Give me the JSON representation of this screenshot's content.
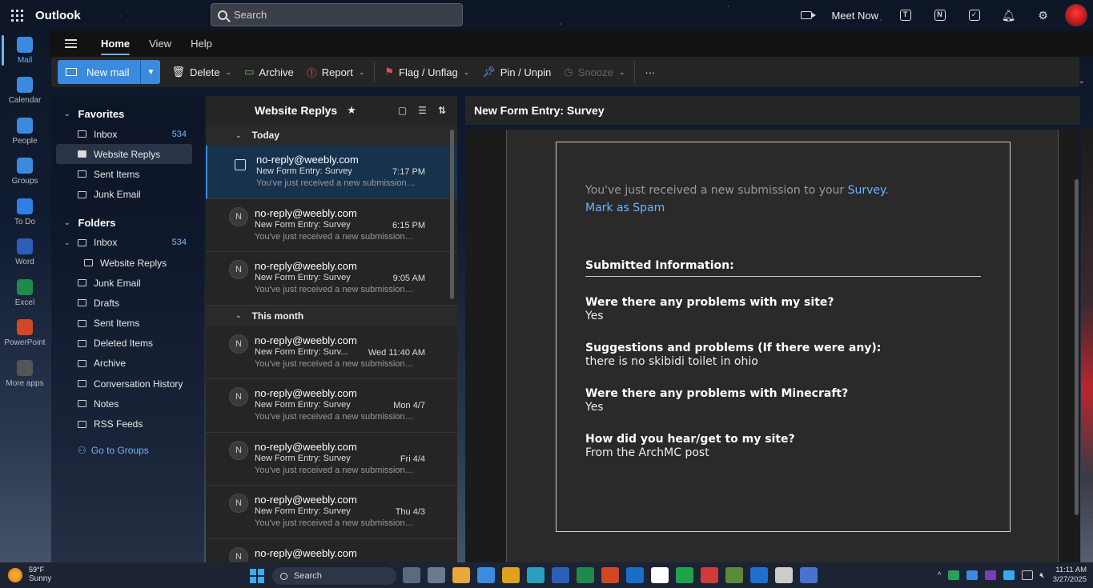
{
  "app": {
    "name": "Outlook",
    "search_placeholder": "Search",
    "meet_now": "Meet Now"
  },
  "rail": [
    {
      "label": "Mail",
      "icon": "mail-icon",
      "color": "#3a8ae0"
    },
    {
      "label": "Calendar",
      "icon": "calendar-icon",
      "color": "#3a8ae0"
    },
    {
      "label": "People",
      "icon": "people-icon",
      "color": "#3a8ae0"
    },
    {
      "label": "Groups",
      "icon": "groups-icon",
      "color": "#3a8ae0"
    },
    {
      "label": "To Do",
      "icon": "todo-icon",
      "color": "#2f7fe6"
    },
    {
      "label": "Word",
      "icon": "word-icon",
      "color": "#2b5fb8"
    },
    {
      "label": "Excel",
      "icon": "excel-icon",
      "color": "#1f8a4c"
    },
    {
      "label": "PowerPoint",
      "icon": "powerpoint-icon",
      "color": "#d24726"
    },
    {
      "label": "More apps",
      "icon": "more-apps-icon",
      "color": "#555555"
    }
  ],
  "menu": {
    "tabs": [
      "Home",
      "View",
      "Help"
    ]
  },
  "ribbon": {
    "new_mail": "New mail",
    "delete": "Delete",
    "archive": "Archive",
    "report": "Report",
    "flag": "Flag / Unflag",
    "pin": "Pin / Unpin",
    "snooze": "Snooze",
    "more": "···"
  },
  "folders": {
    "favorites_title": "Favorites",
    "favorites": [
      {
        "label": "Inbox",
        "count": "534"
      },
      {
        "label": "Website Replys",
        "count": ""
      },
      {
        "label": "Sent Items",
        "count": ""
      },
      {
        "label": "Junk Email",
        "count": ""
      }
    ],
    "folders_title": "Folders",
    "inbox": {
      "label": "Inbox",
      "count": "534"
    },
    "inbox_sub": "Website Replys",
    "items": [
      "Junk Email",
      "Drafts",
      "Sent Items",
      "Deleted Items",
      "Archive",
      "Conversation History",
      "Notes",
      "RSS Feeds"
    ],
    "groups_link": "Go to Groups"
  },
  "message_list": {
    "title": "Website Replys",
    "sections": [
      "Today",
      "This month"
    ],
    "today": [
      {
        "from": "no-reply@weebly.com",
        "subject": "New Form Entry: Survey",
        "time": "7:17 PM",
        "preview": "You've just received a new submission t..."
      },
      {
        "from": "no-reply@weebly.com",
        "subject": "New Form Entry: Survey",
        "time": "6:15 PM",
        "preview": "You've just received a new submission t..."
      },
      {
        "from": "no-reply@weebly.com",
        "subject": "New Form Entry: Survey",
        "time": "9:05 AM",
        "preview": "You've just received a new submission t..."
      }
    ],
    "month": [
      {
        "from": "no-reply@weebly.com",
        "subject": "New Form Entry: Surv...",
        "time": "Wed 11:40 AM",
        "preview": "You've just received a new submission t..."
      },
      {
        "from": "no-reply@weebly.com",
        "subject": "New Form Entry: Survey",
        "time": "Mon 4/7",
        "preview": "You've just received a new submission t..."
      },
      {
        "from": "no-reply@weebly.com",
        "subject": "New Form Entry: Survey",
        "time": "Fri 4/4",
        "preview": "You've just received a new submission t..."
      },
      {
        "from": "no-reply@weebly.com",
        "subject": "New Form Entry: Survey",
        "time": "Thu 4/3",
        "preview": "You've just received a new submission t..."
      },
      {
        "from": "no-reply@weebly.com",
        "subject": "",
        "time": "",
        "preview": ""
      }
    ],
    "avatar_letter": "N"
  },
  "reading": {
    "title": "New Form Entry: Survey",
    "intro_prefix": "You've just received a new submission to your",
    "intro_link": "Survey",
    "intro_suffix": ".",
    "spam": "Mark as Spam",
    "submitted": "Submitted Information:",
    "qa": [
      {
        "q": "Were there any problems with my site?",
        "a": "Yes"
      },
      {
        "q": "Suggestions and problems (If there were any):",
        "a": "there is no skibidi toilet in ohio"
      },
      {
        "q": "Were there any problems with Minecraft?",
        "a": "Yes"
      },
      {
        "q": "How did you hear/get to my site?",
        "a": "From the ArchMC post"
      }
    ]
  },
  "taskbar": {
    "temp": "59°F",
    "weather": "Sunny",
    "search": "Search",
    "time": "11:11 AM",
    "date": "3/27/2025",
    "apps": [
      "file-explorer-icon",
      "settings-icon",
      "folder-icon",
      "store-icon",
      "chrome-icon",
      "edge-icon",
      "word-icon",
      "excel-icon",
      "powerpoint-icon",
      "outlook-icon",
      "app-icon",
      "xbox-icon",
      "game-icon",
      "minecraft-icon",
      "app-icon",
      "roblox-icon",
      "app-icon"
    ],
    "app_colors": [
      "#5a6a80",
      "#6c7a90",
      "#e8a83a",
      "#3b8be0",
      "#e0a020",
      "#2aa0c0",
      "#2b5fb8",
      "#1f8a4c",
      "#d24726",
      "#1a6ec8",
      "#ffffff",
      "#1fa34a",
      "#d23a3a",
      "#5a8a3a",
      "#1d6fd0",
      "#cccccc",
      "#4a70d0"
    ]
  }
}
